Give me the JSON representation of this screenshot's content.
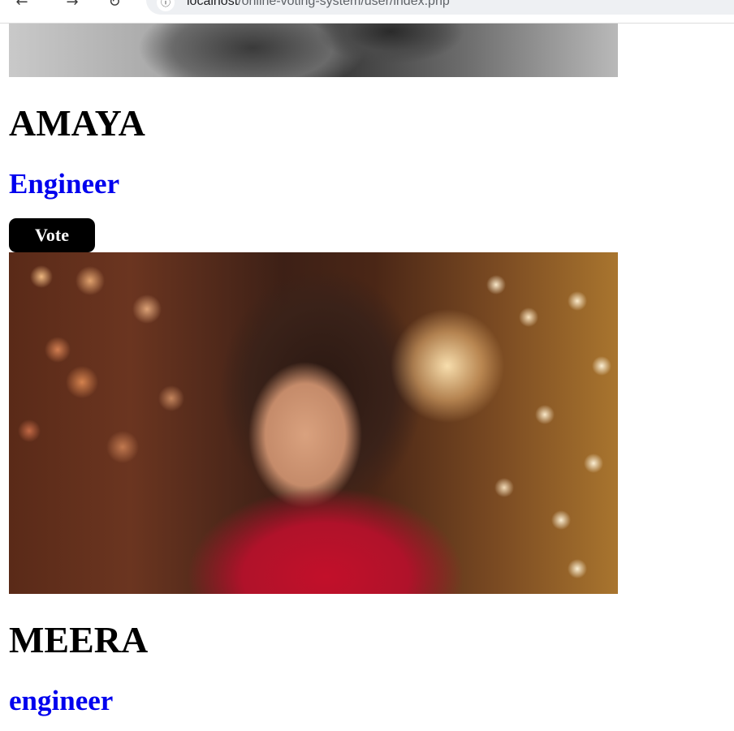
{
  "browser": {
    "url_host": "localhost",
    "url_path": "/online-voting-system/user/index.php",
    "back_icon": "arrow-left-icon",
    "forward_icon": "arrow-right-icon",
    "reload_icon": "reload-icon",
    "site_info_icon": "site-info-icon"
  },
  "candidates": [
    {
      "name": "AMAYA",
      "role": "Engineer",
      "vote_label": "Vote"
    },
    {
      "name": "MEERA",
      "role": "engineer"
    }
  ],
  "colors": {
    "name_color": "#000000",
    "role_color": "#0000ee",
    "vote_button_bg": "#000000",
    "vote_button_text": "#ffffff"
  }
}
